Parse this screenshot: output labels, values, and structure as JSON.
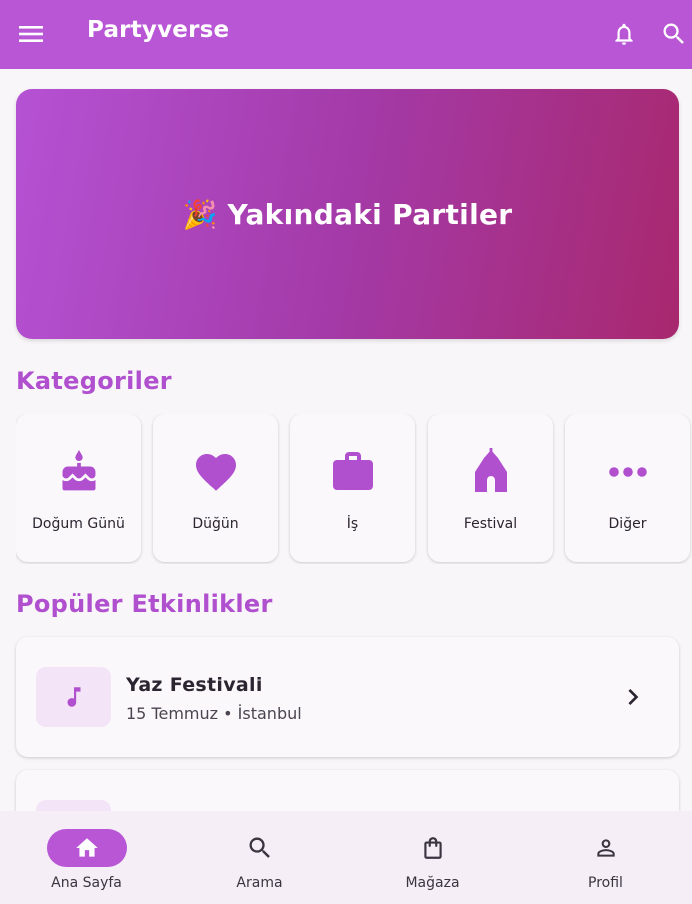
{
  "app": {
    "title": "Partyverse"
  },
  "colors": {
    "primary": "#b856d6",
    "accent_text": "#b050cf",
    "hero_start": "#b552d4",
    "hero_end": "#a8286e",
    "thumb_bg": "#f3e4f7"
  },
  "appbar": {
    "icons": [
      "menu-icon",
      "bell-icon",
      "search-icon"
    ]
  },
  "hero": {
    "emoji": "🎉",
    "title": "Yakındaki Partiler"
  },
  "categories": {
    "title": "Kategoriler",
    "items": [
      {
        "label": "Doğum Günü",
        "icon": "cake-icon"
      },
      {
        "label": "Düğün",
        "icon": "heart-icon"
      },
      {
        "label": "İş",
        "icon": "briefcase-icon"
      },
      {
        "label": "Festival",
        "icon": "venue-icon"
      },
      {
        "label": "Diğer",
        "icon": "more-horiz-icon"
      }
    ]
  },
  "popular": {
    "title": "Popüler Etkinlikler",
    "events": [
      {
        "title": "Yaz Festivali",
        "subtitle": "15 Temmuz • İstanbul",
        "icon": "music-note-icon"
      },
      {
        "title": "",
        "subtitle": "",
        "icon": "music-note-icon"
      }
    ]
  },
  "bottom_nav": {
    "items": [
      {
        "label": "Ana Sayfa",
        "icon": "home-icon",
        "active": true
      },
      {
        "label": "Arama",
        "icon": "search-icon",
        "active": false
      },
      {
        "label": "Mağaza",
        "icon": "shopping-bag-icon",
        "active": false
      },
      {
        "label": "Profil",
        "icon": "person-icon",
        "active": false
      }
    ]
  }
}
